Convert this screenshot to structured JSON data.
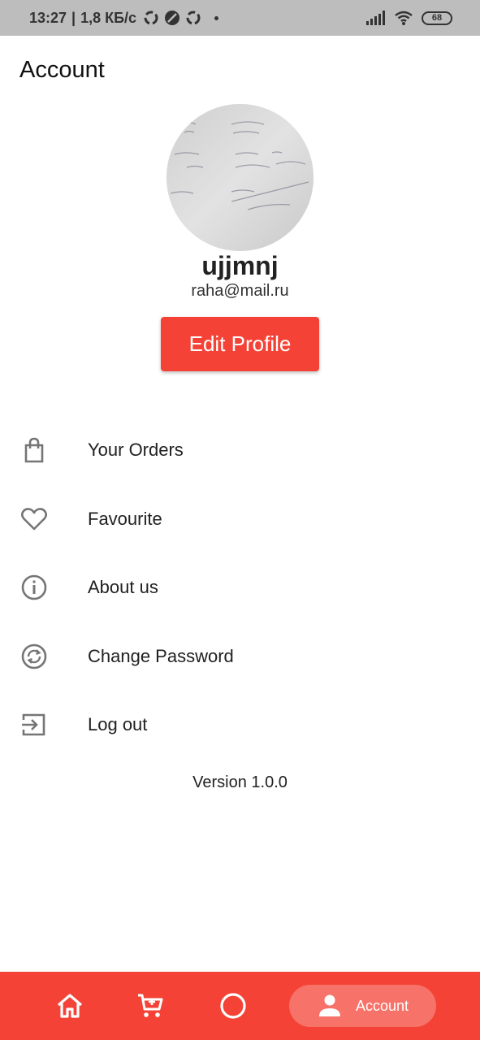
{
  "status_bar": {
    "time": "13:27",
    "network_speed": "1,8 КБ/с",
    "battery": "68",
    "icons": [
      "sync-icon",
      "compass-icon",
      "sync-icon",
      "signal-icon",
      "wifi-icon",
      "battery-icon"
    ]
  },
  "header": {
    "title": "Account"
  },
  "profile": {
    "username": "ujjmnj",
    "email": "raha@mail.ru",
    "edit_button": "Edit Profile"
  },
  "menu": {
    "items": [
      {
        "label": "Your Orders",
        "icon": "shopping-bag-icon"
      },
      {
        "label": "Favourite",
        "icon": "heart-icon"
      },
      {
        "label": "About us",
        "icon": "info-icon"
      },
      {
        "label": "Change Password",
        "icon": "change-password-icon"
      },
      {
        "label": "Log out",
        "icon": "logout-icon"
      }
    ]
  },
  "footer": {
    "version": "Version 1.0.0"
  },
  "bottom_nav": {
    "items": [
      {
        "icon": "home-icon"
      },
      {
        "icon": "cart-icon"
      },
      {
        "icon": "circle-icon"
      },
      {
        "icon": "account-icon",
        "label": "Account",
        "active": true
      }
    ]
  },
  "colors": {
    "accent": "#f44336",
    "status_bar": "#bdbdbd",
    "text": "#212121",
    "icon": "#757575"
  }
}
